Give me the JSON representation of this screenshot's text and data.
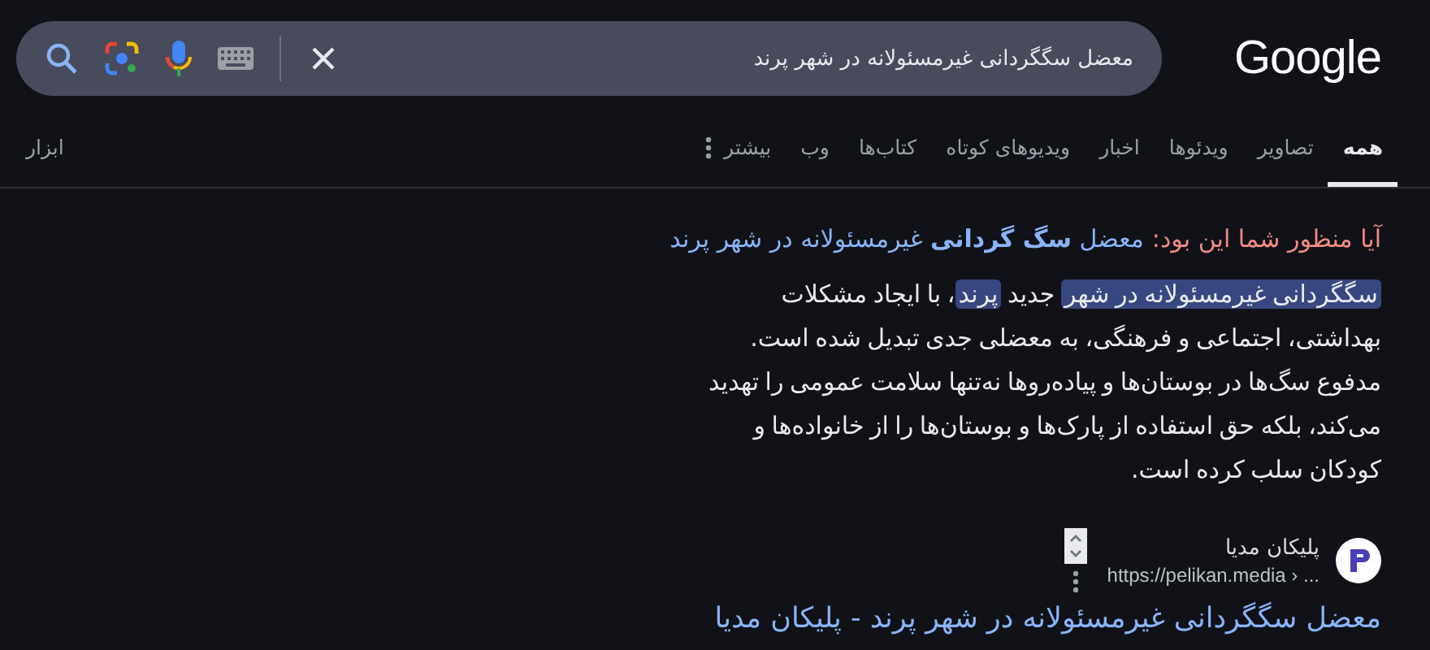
{
  "logo": "Google",
  "search": {
    "value": "معضل سگگردانی غیرمسئولانه در شهر پرند"
  },
  "tabs": [
    {
      "label": "همه",
      "selected": true
    },
    {
      "label": "تصاویر",
      "selected": false
    },
    {
      "label": "ویدئوها",
      "selected": false
    },
    {
      "label": "اخبار",
      "selected": false
    },
    {
      "label": "ویدیوهای کوتاه",
      "selected": false
    },
    {
      "label": "کتاب‌ها",
      "selected": false
    },
    {
      "label": "وب",
      "selected": false
    },
    {
      "label": "بیشتر",
      "selected": false,
      "kind": "more"
    }
  ],
  "tools": "ابزار",
  "did_you_mean": {
    "prompt": "آیا منظور شما این بود:",
    "suggestion": "معضل **سگ گردانی** غیرمسئولانه در شهر پرند"
  },
  "snippet": [
    {
      "text": "سگگردانی غیرمسئولانه در شهر",
      "highlight": true
    },
    {
      "text": " جدید ",
      "highlight": false
    },
    {
      "text": "پرند",
      "highlight": true
    },
    {
      "text": "، با ایجاد مشکلات بهداشتی، اجتماعی و فرهنگی، به معضلی جدی تبدیل شده است. مدفوع سگ‌ها در بوستان‌ها و پیاده‌روها نه‌تنها سلامت عمومی را تهدید می‌کند، بلکه حق استفاده از پارک‌ها و بوستان‌ها را از خانواده‌ها و کودکان سلب کرده است.",
      "highlight": false
    }
  ],
  "result": {
    "site": "پلیکان مدیا",
    "url": "https://pelikan.media › ...",
    "title": "معضل سگگردانی غیرمسئولانه در شهر پرند - پلیکان مدیا"
  }
}
